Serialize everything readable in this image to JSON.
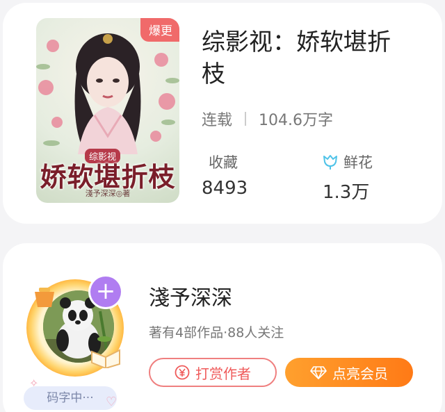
{
  "book": {
    "cover": {
      "badge": "爆更",
      "cover_subtitle": "综影视",
      "cover_title": "娇软堪折枝",
      "cover_author": "淺予深深◎著"
    },
    "title": "综影视：娇软堪折枝",
    "status": "连载",
    "word_count": "104.6万字",
    "stats": {
      "collect_label": "收藏",
      "collect_value": "8493",
      "flower_label": "鲜花",
      "flower_value": "1.3万"
    }
  },
  "author": {
    "name": "淺予深深",
    "meta": "著有4部作品·88人关注",
    "status": "码字中···",
    "follow_symbol": "+",
    "tip_button": "打赏作者",
    "vip_button": "点亮会员",
    "icons": {
      "tip": "yen-coin-icon",
      "vip": "diamond-icon",
      "follow": "plus-icon",
      "flower": "tulip-icon"
    }
  },
  "colors": {
    "accent_orange": "#ff8a1f",
    "accent_red": "#ef5a5a",
    "badge_red": "#f06a6a",
    "purple": "#b07df1",
    "flower_blue": "#4fc3e8"
  }
}
